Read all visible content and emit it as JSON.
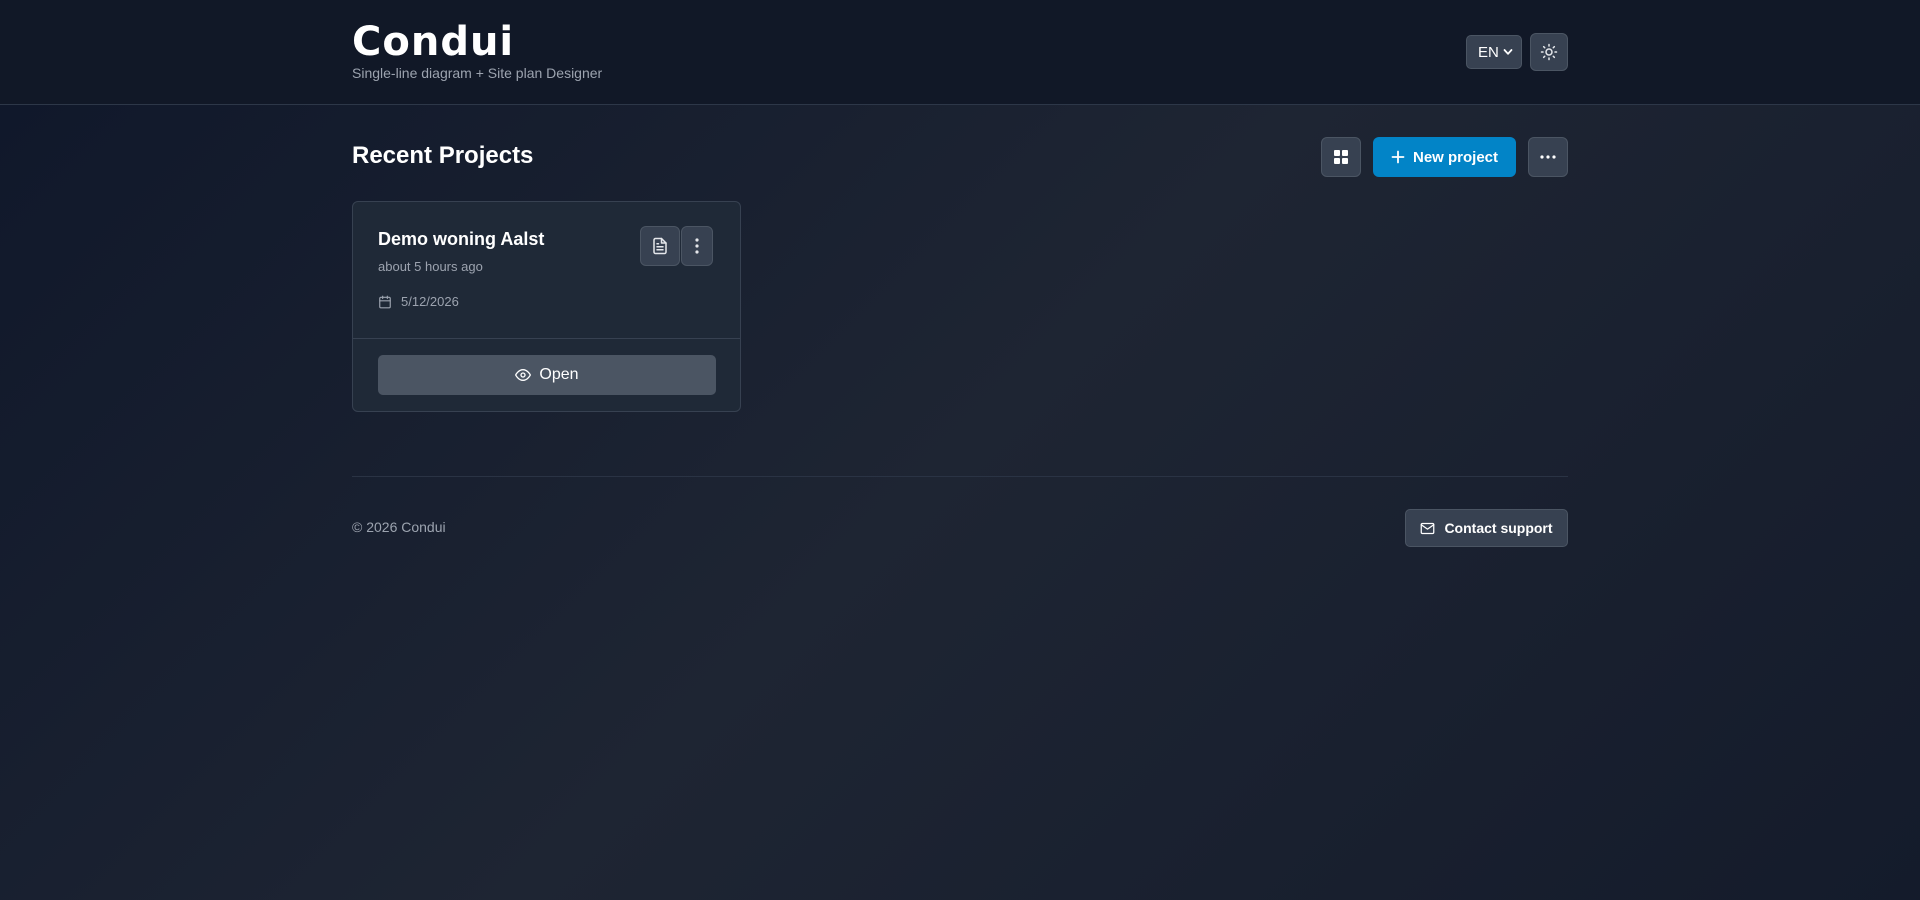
{
  "header": {
    "logo": "Condui",
    "subtitle": "Single-line diagram + Site plan Designer",
    "language": "EN",
    "theme_icon": "sun-icon"
  },
  "main": {
    "title": "Recent Projects",
    "toolbar": {
      "grid_icon": "grid-icon",
      "new_project_label": "New project",
      "more_icon": "ellipsis-icon"
    },
    "projects": [
      {
        "name": "Demo woning Aalst",
        "updated": "about 5 hours ago",
        "date": "5/12/2026",
        "open_label": "Open"
      }
    ]
  },
  "footer": {
    "copyright": "© 2026 Condui",
    "support_label": "Contact support"
  },
  "colors": {
    "primary": "#0284c7",
    "background": "#1e2533",
    "header": "#111827",
    "card": "#1f2937"
  }
}
